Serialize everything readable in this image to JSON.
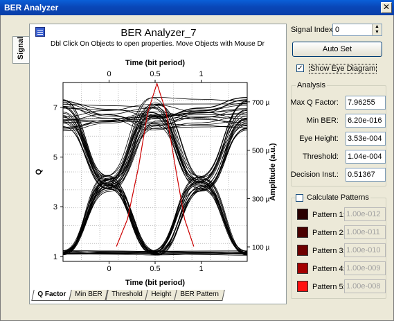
{
  "window": {
    "title": "BER Analyzer",
    "close_symbol": "✕"
  },
  "side_tab": "Signal",
  "graph": {
    "title": "BER Analyzer_7",
    "subtitle": "Dbl Click On Objects to open properties.  Move Objects with Mouse Dr",
    "x_label_top": "Time (bit period)",
    "x_label_bottom": "Time (bit period)",
    "y_label_left": "Q",
    "y_label_right": "Amplitude (a.u.)",
    "x_ticks": [
      "0",
      "0.5",
      "1"
    ],
    "y_left_ticks": [
      "7",
      "5",
      "3",
      "1"
    ],
    "y_right_ticks": [
      "700 µ",
      "500 µ",
      "300 µ",
      "100 µ"
    ]
  },
  "chart_data": {
    "type": "line",
    "title": "BER Analyzer_7",
    "xlabel": "Time (bit period)",
    "ylabel": "Q",
    "y2label": "Amplitude (a.u.)",
    "xlim": [
      -0.5,
      1.5
    ],
    "ylim_q": [
      0.8,
      8.0
    ],
    "ylim_amplitude": [
      4e-05,
      0.00078
    ],
    "series": [
      {
        "color": "#cc0000",
        "x": [
          0.08,
          0.2,
          0.32,
          0.42,
          0.52,
          0.62,
          0.72,
          0.82,
          0.92
        ],
        "values": [
          1.4,
          2.5,
          4.6,
          6.8,
          7.96,
          6.8,
          4.6,
          2.5,
          1.4
        ]
      }
    ],
    "grid": true
  },
  "bottom_tabs": [
    "Q Factor",
    "Min BER",
    "Threshold",
    "Height",
    "BER Pattern"
  ],
  "controls": {
    "signal_index_label": "Signal Index:",
    "signal_index_value": "0",
    "auto_set": "Auto Set",
    "show_eye_label": "Show Eye Diagram",
    "show_eye_checked": "✓",
    "analysis_legend": "Analysis",
    "analysis": [
      {
        "label": "Max Q Factor:",
        "value": "7.96255"
      },
      {
        "label": "Min BER:",
        "value": "6.20e-016"
      },
      {
        "label": "Eye Height:",
        "value": "3.53e-004"
      },
      {
        "label": "Threshold:",
        "value": "1.04e-004"
      },
      {
        "label": "Decision Inst.:",
        "value": "0.51367"
      }
    ],
    "calc_patterns_label": "Calculate Patterns",
    "patterns": [
      {
        "label": "Pattern 1:",
        "value": "1.00e-012",
        "color": "#2a0000"
      },
      {
        "label": "Pattern 2:",
        "value": "1.00e-011",
        "color": "#4a0000"
      },
      {
        "label": "Pattern 3:",
        "value": "1.00e-010",
        "color": "#6e0000"
      },
      {
        "label": "Pattern 4:",
        "value": "1.00e-009",
        "color": "#a40000"
      },
      {
        "label": "Pattern 5:",
        "value": "1.00e-008",
        "color": "#ff1010"
      }
    ]
  }
}
